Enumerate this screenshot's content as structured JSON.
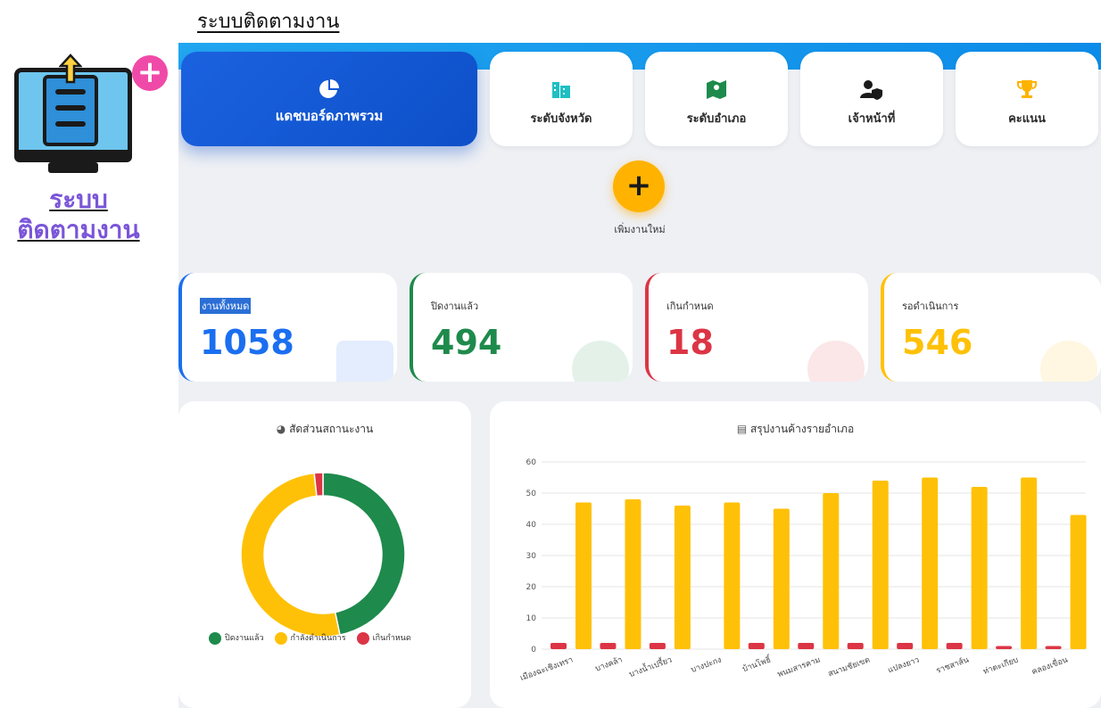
{
  "page": {
    "title": "ระบบติดตามงาน"
  },
  "logo": {
    "line1": "ระบบ",
    "line2": "ติดตามงาน",
    "plus": "+"
  },
  "tabs": [
    {
      "label": "แดชบอร์ดภาพรวม",
      "icon": "pie-chart-icon",
      "icon_color": "#ffffff"
    },
    {
      "label": "ระดับจังหวัด",
      "icon": "city-icon",
      "icon_color": "#1fbfc2"
    },
    {
      "label": "ระดับอำเภอ",
      "icon": "map-icon",
      "icon_color": "#1e8a4c"
    },
    {
      "label": "เจ้าหน้าที่",
      "icon": "user-shield-icon",
      "icon_color": "#1a1a1a"
    },
    {
      "label": "คะแนน",
      "icon": "trophy-icon",
      "icon_color": "#ffb300"
    }
  ],
  "add_button": {
    "symbol": "+",
    "label": "เพิ่มงานใหม่"
  },
  "stats": [
    {
      "label": "งานทั้งหมด",
      "value": "1058",
      "color": "#1a6ff0",
      "border": "#1a6ff0"
    },
    {
      "label": "ปิดงานแล้ว",
      "value": "494",
      "color": "#1e8a4c",
      "border": "#1e8a4c"
    },
    {
      "label": "เกินกำหนด",
      "value": "18",
      "color": "#dc3545",
      "border": "#dc3545"
    },
    {
      "label": "รอดำเนินการ",
      "value": "546",
      "color": "#ffc107",
      "border": "#ffc107"
    }
  ],
  "donut_panel": {
    "title": "สัดส่วนสถานะงาน"
  },
  "bar_panel": {
    "title": "สรุปงานค้างรายอำเภอ"
  },
  "chart_data": [
    {
      "type": "pie",
      "title": "สัดส่วนสถานะงาน",
      "categories": [
        "ปิดงานแล้ว",
        "กำลังดำเนินการ",
        "เกินกำหนด"
      ],
      "values": [
        494,
        546,
        18
      ],
      "colors": [
        "#1e8a4c",
        "#ffc107",
        "#dc3545"
      ],
      "legend": "bottom"
    },
    {
      "type": "bar",
      "title": "สรุปงานค้างรายอำเภอ",
      "categories": [
        "เมืองฉะเชิงเทรา",
        "บางคล้า",
        "บางน้ำเปรี้ยว",
        "บางปะกง",
        "บ้านโพธิ์",
        "พนมสารคาม",
        "สนามชัยเขต",
        "แปลงยาว",
        "ราชสาส์น",
        "ท่าตะเกียบ",
        "คลองเขื่อน"
      ],
      "series": [
        {
          "values": [
            2,
            2,
            2,
            0,
            2,
            2,
            2,
            2,
            2,
            1,
            1
          ],
          "color": "#dc3545"
        },
        {
          "values": [
            47,
            48,
            46,
            47,
            45,
            50,
            54,
            55,
            52,
            55,
            43
          ],
          "color": "#ffc107"
        }
      ],
      "ylim": [
        0,
        60
      ],
      "yticks": [
        0,
        10,
        20,
        30,
        40,
        50,
        60
      ],
      "grid": true
    }
  ]
}
